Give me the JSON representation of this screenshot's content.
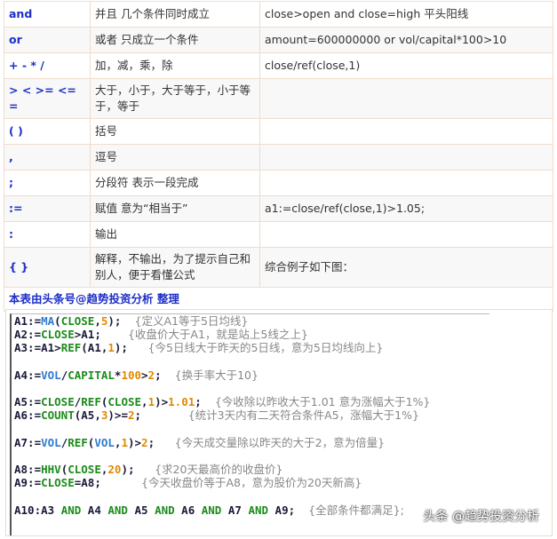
{
  "table": {
    "rows": [
      {
        "op": "and",
        "desc": "并且 几个条件同时成立",
        "example": "close>open and close=high 平头阳线"
      },
      {
        "op": "or",
        "desc": "或者 只成立一个条件",
        "example": "amount=600000000 or vol/capital*100>10"
      },
      {
        "op": "+ - * /",
        "desc": "加，减，乘，除",
        "example": "close/ref(close,1)"
      },
      {
        "op": "> < >= <= =",
        "desc": "大于，小于，大于等于，小于等于，等于",
        "example": ""
      },
      {
        "op": "( )",
        "desc": "括号",
        "example": ""
      },
      {
        "op": ",",
        "desc": "逗号",
        "example": ""
      },
      {
        "op": " ;",
        "desc": "分段符 表示一段完成",
        "example": ""
      },
      {
        "op": ":=",
        "desc": "赋值 意为“相当于”",
        "example": "a1:=close/ref(close,1)>1.05;"
      },
      {
        "op": ":",
        "desc": "输出",
        "example": ""
      },
      {
        "op": "{ }",
        "desc": "解释，不输出，为了提示自己和别人，便于看懂公式",
        "example": "综合例子如下图："
      }
    ],
    "footer": "本表由头条号@趋势投资分析 整理"
  },
  "code": [
    [
      [
        "A1:=",
        "v"
      ],
      [
        "MA",
        "f"
      ],
      [
        "(",
        "v"
      ],
      [
        "CLOSE",
        "g"
      ],
      [
        ",",
        "v"
      ],
      [
        "5",
        "n"
      ],
      [
        ");  ",
        "v"
      ],
      [
        "{定义A1等于5日均线}",
        "c"
      ]
    ],
    [
      [
        "A2:=",
        "v"
      ],
      [
        "CLOSE",
        "g"
      ],
      [
        ">A1;    ",
        "v"
      ],
      [
        "{收盘价大于A1，就是站上5线之上}",
        "c"
      ]
    ],
    [
      [
        "A3:=A1>",
        "v"
      ],
      [
        "REF",
        "g"
      ],
      [
        "(A1,",
        "v"
      ],
      [
        "1",
        "n"
      ],
      [
        ");   ",
        "v"
      ],
      [
        "{今5日线大于昨天的5日线，意为5日均线向上}",
        "c"
      ]
    ],
    [],
    [
      [
        "A4:=",
        "v"
      ],
      [
        "VOL",
        "f"
      ],
      [
        "/",
        "v"
      ],
      [
        "CAPITAL",
        "g"
      ],
      [
        "*",
        "v"
      ],
      [
        "100",
        "n"
      ],
      [
        ">",
        "v"
      ],
      [
        "2",
        "n"
      ],
      [
        ";  ",
        "v"
      ],
      [
        "{换手率大于10}",
        "c"
      ]
    ],
    [],
    [
      [
        "A5:=",
        "v"
      ],
      [
        "CLOSE",
        "g"
      ],
      [
        "/",
        "v"
      ],
      [
        "REF",
        "g"
      ],
      [
        "(",
        "v"
      ],
      [
        "CLOSE",
        "g"
      ],
      [
        ",",
        "v"
      ],
      [
        "1",
        "n"
      ],
      [
        ")>",
        "v"
      ],
      [
        "1.01",
        "n"
      ],
      [
        ";  ",
        "v"
      ],
      [
        "{今收除以昨收大于1.01 意为涨幅大于1%}",
        "c"
      ]
    ],
    [
      [
        "A6:=",
        "v"
      ],
      [
        "COUNT",
        "g"
      ],
      [
        "(A5,",
        "v"
      ],
      [
        "3",
        "n"
      ],
      [
        ")>=",
        "v"
      ],
      [
        "2",
        "n"
      ],
      [
        ";       ",
        "v"
      ],
      [
        "{统计3天内有二天符合条件A5，涨幅大于1%}",
        "c"
      ]
    ],
    [],
    [
      [
        "A7:=",
        "v"
      ],
      [
        "VOL",
        "f"
      ],
      [
        "/",
        "v"
      ],
      [
        "REF",
        "g"
      ],
      [
        "(",
        "v"
      ],
      [
        "VOL",
        "f"
      ],
      [
        ",",
        "v"
      ],
      [
        "1",
        "n"
      ],
      [
        ")>",
        "v"
      ],
      [
        "2",
        "n"
      ],
      [
        ";   ",
        "v"
      ],
      [
        "{今天成交量除以昨天的大于2，意为倍量}",
        "c"
      ]
    ],
    [],
    [
      [
        "A8:=",
        "v"
      ],
      [
        "HHV",
        "g"
      ],
      [
        "(",
        "v"
      ],
      [
        "CLOSE",
        "g"
      ],
      [
        ",",
        "v"
      ],
      [
        "20",
        "n"
      ],
      [
        ");   ",
        "v"
      ],
      [
        "{求20天最高价的收盘价}",
        "c"
      ]
    ],
    [
      [
        "A9:=",
        "v"
      ],
      [
        "CLOSE",
        "g"
      ],
      [
        "=A8;      ",
        "v"
      ],
      [
        "{今天收盘价等于A8，意为股价为20天新高}",
        "c"
      ]
    ],
    [],
    [
      [
        "A10:A3 ",
        "v"
      ],
      [
        "AND",
        "g"
      ],
      [
        " A4 ",
        "v"
      ],
      [
        "AND",
        "g"
      ],
      [
        " A5 ",
        "v"
      ],
      [
        "AND",
        "g"
      ],
      [
        " A6 ",
        "v"
      ],
      [
        "AND",
        "g"
      ],
      [
        " A7 ",
        "v"
      ],
      [
        "AND",
        "g"
      ],
      [
        " A9;  ",
        "v"
      ],
      [
        "{全部条件都满足};",
        "c"
      ]
    ]
  ],
  "watermark": "头条 @趋势投资分析",
  "colors": {
    "operator": "#1e2fc8",
    "function_blue": "#2f7bd0",
    "keyword_green": "#1a8c1a",
    "number": "#e08a00",
    "comment": "#888888"
  }
}
